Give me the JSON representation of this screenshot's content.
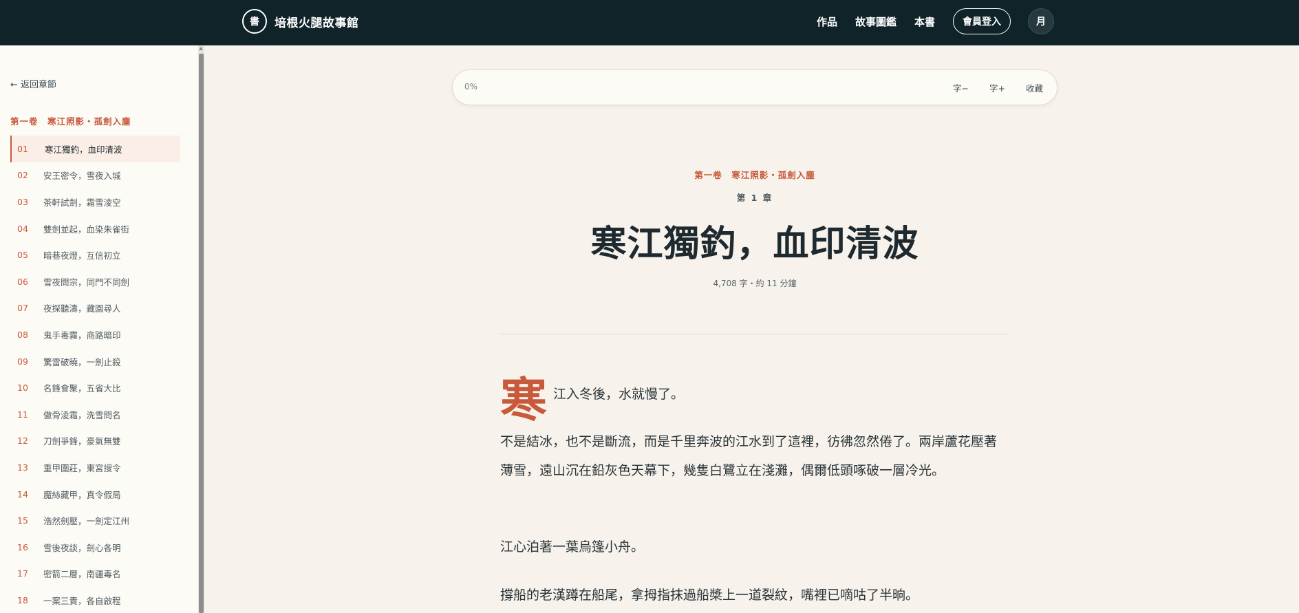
{
  "header": {
    "logo_glyph": "書",
    "title": "培根火腿故事館",
    "nav": [
      "作品",
      "故事圖鑑",
      "本書"
    ],
    "login_label": "會員登入",
    "theme_glyph": "月"
  },
  "sidebar": {
    "back_label": "← 返回章節",
    "volume_title": "第一卷　寒江照影・孤劍入塵",
    "chapters": [
      {
        "num": "01",
        "title": "寒江獨釣，血印清波"
      },
      {
        "num": "02",
        "title": "安王密令，雪夜入城"
      },
      {
        "num": "03",
        "title": "茶軒試劍，霜雪淩空"
      },
      {
        "num": "04",
        "title": "雙劍並起，血染朱雀街"
      },
      {
        "num": "05",
        "title": "暗巷夜燈，互信初立"
      },
      {
        "num": "06",
        "title": "雪夜問宗，同門不同劍"
      },
      {
        "num": "07",
        "title": "夜探聽濤，藏園尋人"
      },
      {
        "num": "08",
        "title": "鬼手毒霧，商路暗印"
      },
      {
        "num": "09",
        "title": "驚雷破曉，一劍止殺"
      },
      {
        "num": "10",
        "title": "名鋒會聚，五省大比"
      },
      {
        "num": "11",
        "title": "傲骨淩霜，洗雪問名"
      },
      {
        "num": "12",
        "title": "刀劍爭鋒，豪氣無雙"
      },
      {
        "num": "13",
        "title": "重甲圍莊，東宮搜令"
      },
      {
        "num": "14",
        "title": "魔絲藏甲，真令假局"
      },
      {
        "num": "15",
        "title": "浩然劍壓，一劍定江州"
      },
      {
        "num": "16",
        "title": "雪後夜談，劍心各明"
      },
      {
        "num": "17",
        "title": "密箭二層，南疆毒名"
      },
      {
        "num": "18",
        "title": "一案三責，各自啟程"
      }
    ]
  },
  "reader": {
    "progress": "0%",
    "font_smaller": "字−",
    "font_larger": "字+",
    "bookmark": "收藏"
  },
  "chapter": {
    "volume": "第一卷　寒江照影・孤劍入塵",
    "number": "第 1 章",
    "title": "寒江獨釣，血印清波",
    "meta": "4,708 字・約 11 分鐘",
    "drop_cap": "寒",
    "paragraphs": [
      "江入冬後，水就慢了。",
      "不是結冰，也不是斷流，而是千里奔波的江水到了這裡，彷彿忽然倦了。兩岸蘆花壓著薄雪，遠山沉在鉛灰色天幕下，幾隻白鷺立在淺灘，偶爾低頭啄破一層冷光。",
      "江心泊著一葉烏篷小舟。",
      "撐船的老漢蹲在船尾，拿拇指抹過船槳上一道裂紋，嘴裡已嘀咕了半晌。"
    ]
  }
}
